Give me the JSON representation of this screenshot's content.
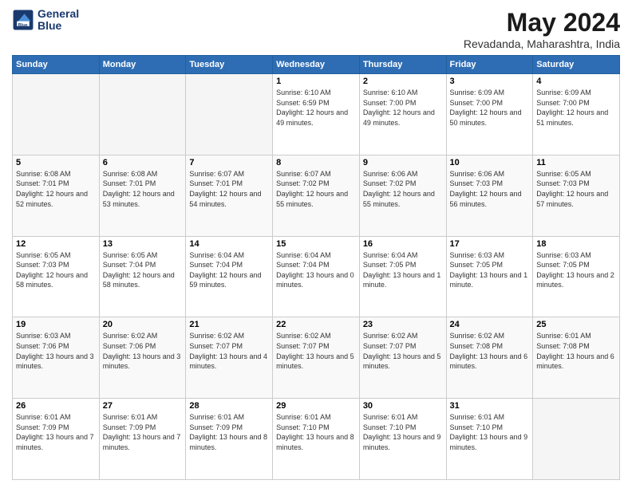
{
  "header": {
    "logo_line1": "General",
    "logo_line2": "Blue",
    "month": "May 2024",
    "location": "Revadanda, Maharashtra, India"
  },
  "days_of_week": [
    "Sunday",
    "Monday",
    "Tuesday",
    "Wednesday",
    "Thursday",
    "Friday",
    "Saturday"
  ],
  "weeks": [
    [
      {
        "day": "",
        "empty": true
      },
      {
        "day": "",
        "empty": true
      },
      {
        "day": "",
        "empty": true
      },
      {
        "day": "1",
        "sunrise": "Sunrise: 6:10 AM",
        "sunset": "Sunset: 6:59 PM",
        "daylight": "Daylight: 12 hours and 49 minutes."
      },
      {
        "day": "2",
        "sunrise": "Sunrise: 6:10 AM",
        "sunset": "Sunset: 7:00 PM",
        "daylight": "Daylight: 12 hours and 49 minutes."
      },
      {
        "day": "3",
        "sunrise": "Sunrise: 6:09 AM",
        "sunset": "Sunset: 7:00 PM",
        "daylight": "Daylight: 12 hours and 50 minutes."
      },
      {
        "day": "4",
        "sunrise": "Sunrise: 6:09 AM",
        "sunset": "Sunset: 7:00 PM",
        "daylight": "Daylight: 12 hours and 51 minutes."
      }
    ],
    [
      {
        "day": "5",
        "sunrise": "Sunrise: 6:08 AM",
        "sunset": "Sunset: 7:01 PM",
        "daylight": "Daylight: 12 hours and 52 minutes."
      },
      {
        "day": "6",
        "sunrise": "Sunrise: 6:08 AM",
        "sunset": "Sunset: 7:01 PM",
        "daylight": "Daylight: 12 hours and 53 minutes."
      },
      {
        "day": "7",
        "sunrise": "Sunrise: 6:07 AM",
        "sunset": "Sunset: 7:01 PM",
        "daylight": "Daylight: 12 hours and 54 minutes."
      },
      {
        "day": "8",
        "sunrise": "Sunrise: 6:07 AM",
        "sunset": "Sunset: 7:02 PM",
        "daylight": "Daylight: 12 hours and 55 minutes."
      },
      {
        "day": "9",
        "sunrise": "Sunrise: 6:06 AM",
        "sunset": "Sunset: 7:02 PM",
        "daylight": "Daylight: 12 hours and 55 minutes."
      },
      {
        "day": "10",
        "sunrise": "Sunrise: 6:06 AM",
        "sunset": "Sunset: 7:03 PM",
        "daylight": "Daylight: 12 hours and 56 minutes."
      },
      {
        "day": "11",
        "sunrise": "Sunrise: 6:05 AM",
        "sunset": "Sunset: 7:03 PM",
        "daylight": "Daylight: 12 hours and 57 minutes."
      }
    ],
    [
      {
        "day": "12",
        "sunrise": "Sunrise: 6:05 AM",
        "sunset": "Sunset: 7:03 PM",
        "daylight": "Daylight: 12 hours and 58 minutes."
      },
      {
        "day": "13",
        "sunrise": "Sunrise: 6:05 AM",
        "sunset": "Sunset: 7:04 PM",
        "daylight": "Daylight: 12 hours and 58 minutes."
      },
      {
        "day": "14",
        "sunrise": "Sunrise: 6:04 AM",
        "sunset": "Sunset: 7:04 PM",
        "daylight": "Daylight: 12 hours and 59 minutes."
      },
      {
        "day": "15",
        "sunrise": "Sunrise: 6:04 AM",
        "sunset": "Sunset: 7:04 PM",
        "daylight": "Daylight: 13 hours and 0 minutes."
      },
      {
        "day": "16",
        "sunrise": "Sunrise: 6:04 AM",
        "sunset": "Sunset: 7:05 PM",
        "daylight": "Daylight: 13 hours and 1 minute."
      },
      {
        "day": "17",
        "sunrise": "Sunrise: 6:03 AM",
        "sunset": "Sunset: 7:05 PM",
        "daylight": "Daylight: 13 hours and 1 minute."
      },
      {
        "day": "18",
        "sunrise": "Sunrise: 6:03 AM",
        "sunset": "Sunset: 7:05 PM",
        "daylight": "Daylight: 13 hours and 2 minutes."
      }
    ],
    [
      {
        "day": "19",
        "sunrise": "Sunrise: 6:03 AM",
        "sunset": "Sunset: 7:06 PM",
        "daylight": "Daylight: 13 hours and 3 minutes."
      },
      {
        "day": "20",
        "sunrise": "Sunrise: 6:02 AM",
        "sunset": "Sunset: 7:06 PM",
        "daylight": "Daylight: 13 hours and 3 minutes."
      },
      {
        "day": "21",
        "sunrise": "Sunrise: 6:02 AM",
        "sunset": "Sunset: 7:07 PM",
        "daylight": "Daylight: 13 hours and 4 minutes."
      },
      {
        "day": "22",
        "sunrise": "Sunrise: 6:02 AM",
        "sunset": "Sunset: 7:07 PM",
        "daylight": "Daylight: 13 hours and 5 minutes."
      },
      {
        "day": "23",
        "sunrise": "Sunrise: 6:02 AM",
        "sunset": "Sunset: 7:07 PM",
        "daylight": "Daylight: 13 hours and 5 minutes."
      },
      {
        "day": "24",
        "sunrise": "Sunrise: 6:02 AM",
        "sunset": "Sunset: 7:08 PM",
        "daylight": "Daylight: 13 hours and 6 minutes."
      },
      {
        "day": "25",
        "sunrise": "Sunrise: 6:01 AM",
        "sunset": "Sunset: 7:08 PM",
        "daylight": "Daylight: 13 hours and 6 minutes."
      }
    ],
    [
      {
        "day": "26",
        "sunrise": "Sunrise: 6:01 AM",
        "sunset": "Sunset: 7:09 PM",
        "daylight": "Daylight: 13 hours and 7 minutes."
      },
      {
        "day": "27",
        "sunrise": "Sunrise: 6:01 AM",
        "sunset": "Sunset: 7:09 PM",
        "daylight": "Daylight: 13 hours and 7 minutes."
      },
      {
        "day": "28",
        "sunrise": "Sunrise: 6:01 AM",
        "sunset": "Sunset: 7:09 PM",
        "daylight": "Daylight: 13 hours and 8 minutes."
      },
      {
        "day": "29",
        "sunrise": "Sunrise: 6:01 AM",
        "sunset": "Sunset: 7:10 PM",
        "daylight": "Daylight: 13 hours and 8 minutes."
      },
      {
        "day": "30",
        "sunrise": "Sunrise: 6:01 AM",
        "sunset": "Sunset: 7:10 PM",
        "daylight": "Daylight: 13 hours and 9 minutes."
      },
      {
        "day": "31",
        "sunrise": "Sunrise: 6:01 AM",
        "sunset": "Sunset: 7:10 PM",
        "daylight": "Daylight: 13 hours and 9 minutes."
      },
      {
        "day": "",
        "empty": true
      }
    ]
  ]
}
